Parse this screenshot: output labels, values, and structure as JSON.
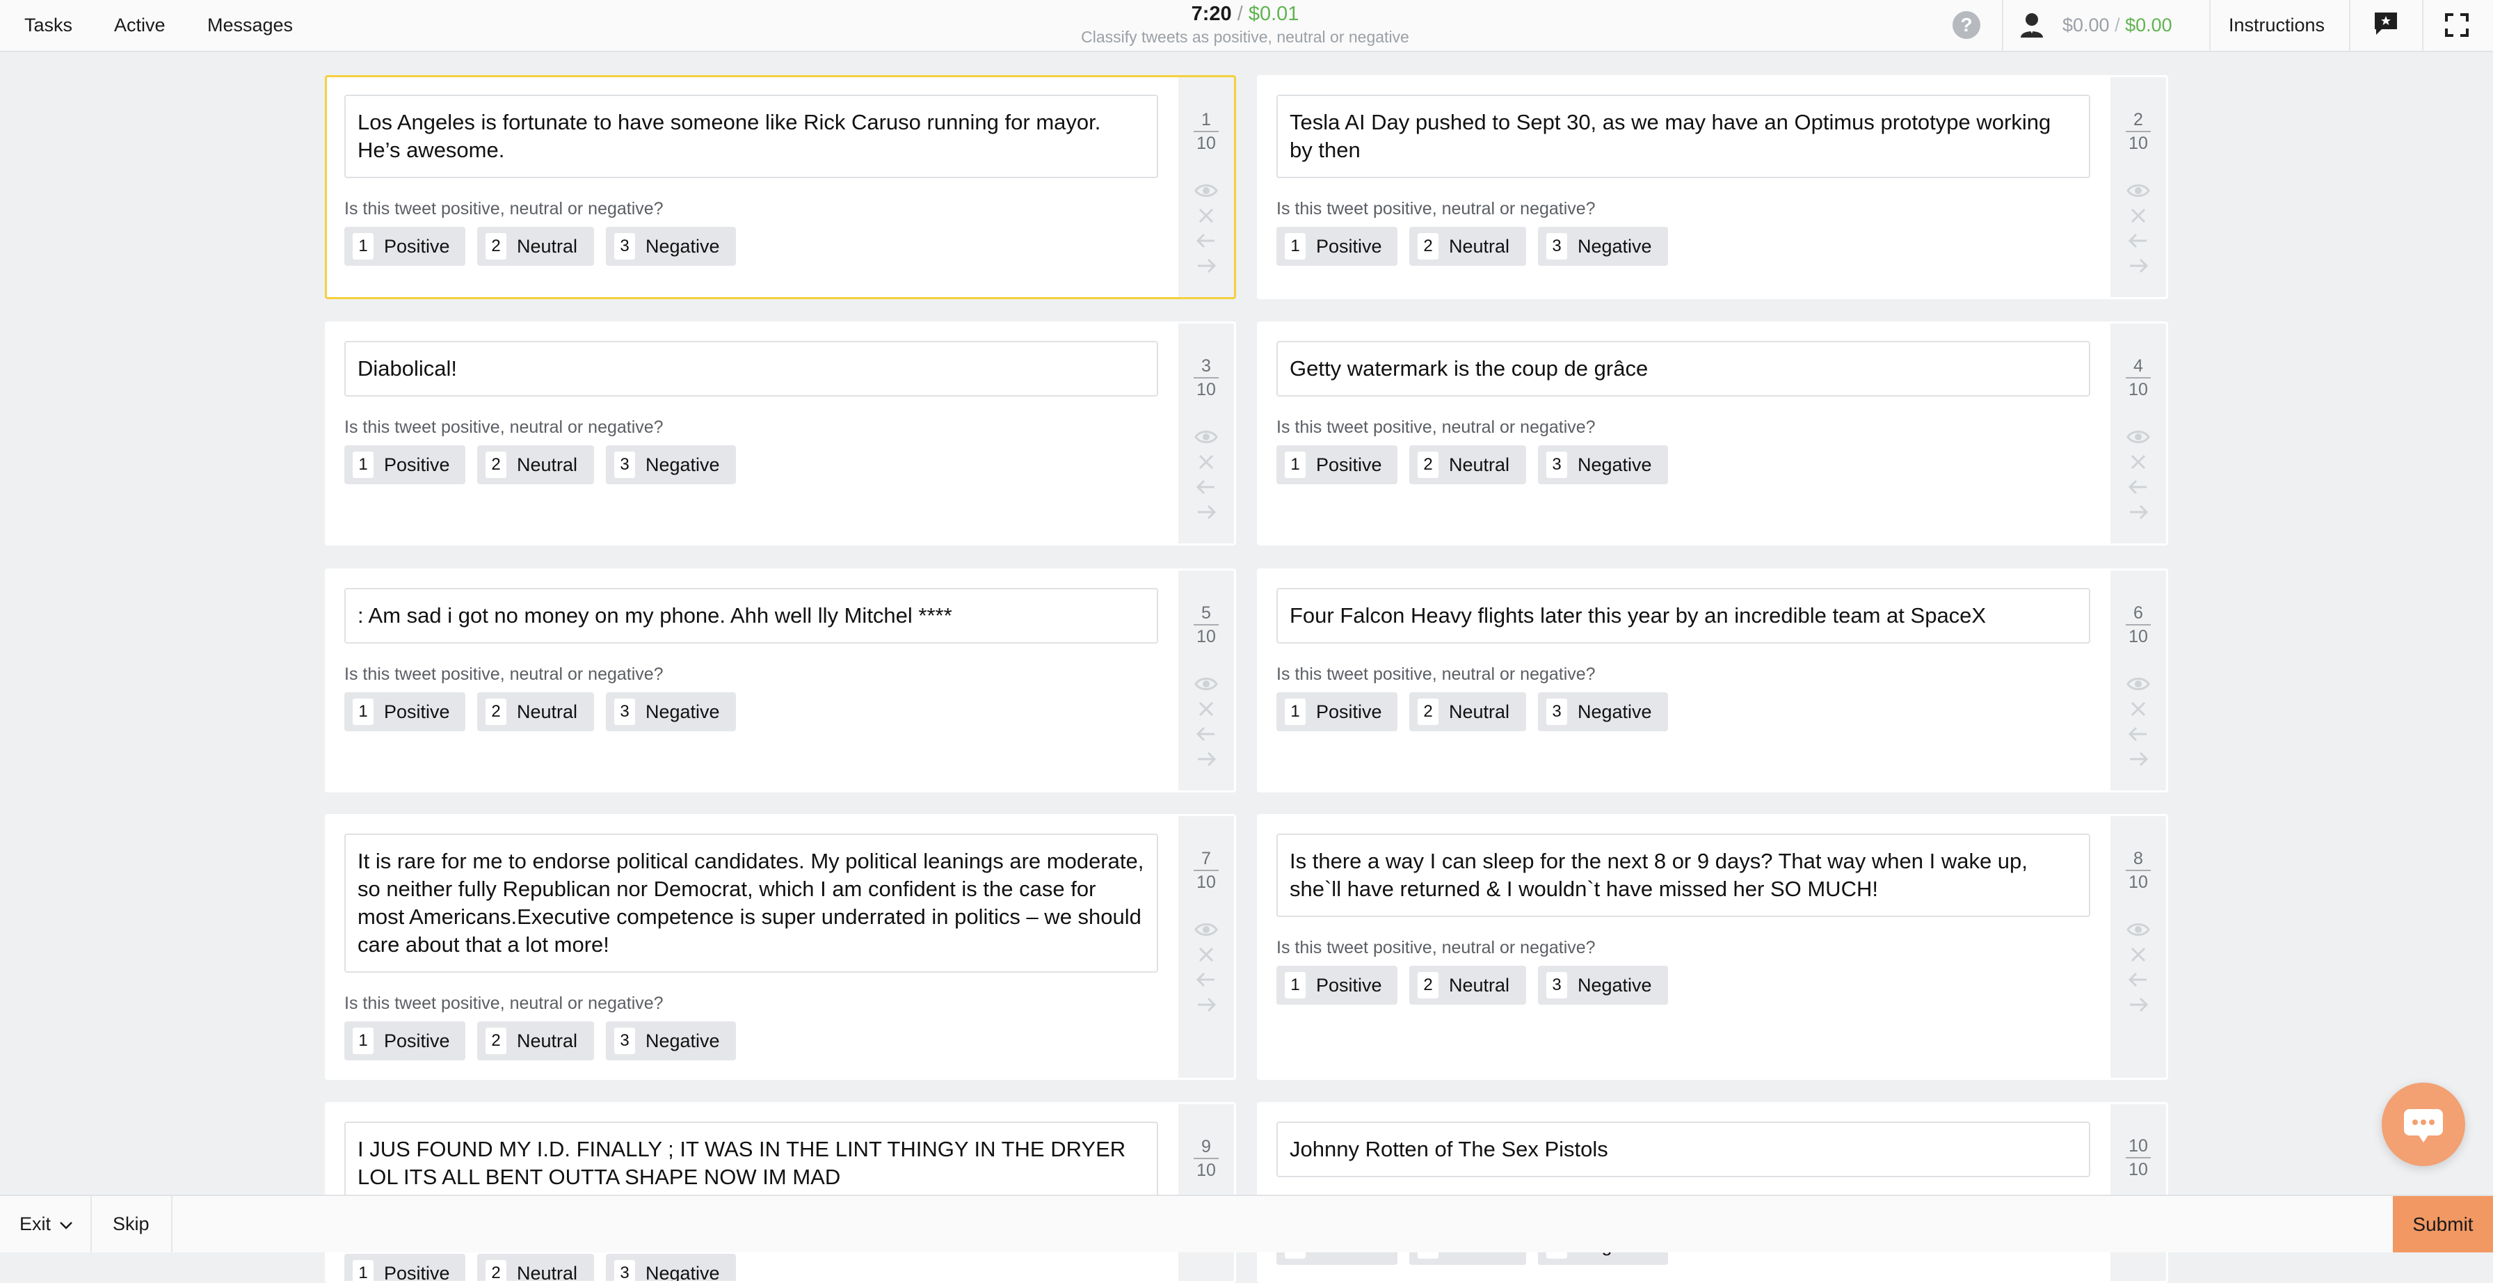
{
  "nav": {
    "tasks": "Tasks",
    "active": "Active",
    "messages": "Messages"
  },
  "timer": {
    "time": "7:20",
    "separator": "/",
    "earned": "$0.01",
    "description": "Classify tweets as positive, neutral or negative"
  },
  "header": {
    "help_icon": "?",
    "balance_a": "$0.00",
    "balance_sep": "/",
    "balance_b": "$0.00",
    "instructions": "Instructions"
  },
  "question": "Is this tweet positive, neutral or negative?",
  "options": [
    {
      "key": "1",
      "label": "Positive"
    },
    {
      "key": "2",
      "label": "Neutral"
    },
    {
      "key": "3",
      "label": "Negative"
    }
  ],
  "total": "10",
  "tasks": [
    {
      "num": "1",
      "text": "Los Angeles is fortunate to have someone like Rick Caruso running for mayor. He’s awesome."
    },
    {
      "num": "2",
      "text": "Tesla AI Day pushed to Sept 30, as we may have an Optimus prototype working by then"
    },
    {
      "num": "3",
      "text": "Diabolical!"
    },
    {
      "num": "4",
      "text": "Getty watermark is the coup de grâce"
    },
    {
      "num": "5",
      "text": ": Am sad i got no money on my phone. Ahh well  lly Mitchel ****"
    },
    {
      "num": "6",
      "text": "Four Falcon Heavy flights later this year by an incredible team at SpaceX"
    },
    {
      "num": "7",
      "text": "It is rare for me to endorse political candidates. My political leanings are moderate, so neither fully Republican nor Democrat, which I am confident is the case for most Americans.Executive competence is super underrated in politics – we should care about that a lot more!"
    },
    {
      "num": "8",
      "text": "Is there a way I can sleep for the next 8 or 9 days? That way when I wake up, she`ll have returned & I wouldn`t have missed her SO MUCH!"
    },
    {
      "num": "9",
      "text": "I JUS FOUND MY I.D. FINALLY ; IT WAS IN THE LINT THINGY IN THE DRYER LOL ITS ALL BENT OUTTA SHAPE NOW  IM MAD"
    },
    {
      "num": "10",
      "text": "Johnny Rotten of The Sex Pistols"
    }
  ],
  "footer": {
    "exit": "Exit",
    "skip": "Skip",
    "submit": "Submit"
  },
  "colors": {
    "accent_green": "#5fb550",
    "selected_border": "#f5cf3f",
    "submit_bg": "#f29863",
    "chat_bg": "#f3a072"
  },
  "icons": [
    "help-icon",
    "person-icon",
    "chat-icon",
    "fullscreen-icon",
    "eye-icon",
    "close-icon",
    "arrow-left-icon",
    "arrow-right-icon",
    "chevron-down-icon"
  ]
}
